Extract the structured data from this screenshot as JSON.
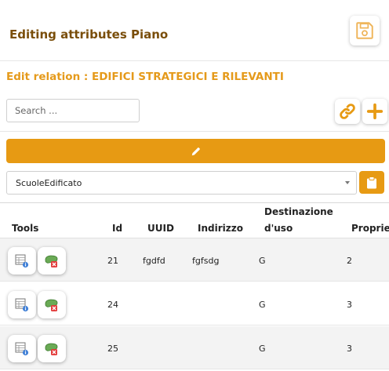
{
  "header": {
    "title": "Editing attributes Piano",
    "save_icon": "floppy-disk-icon"
  },
  "relation": {
    "title": "Edit relation : EDIFICI STRATEGICI E RILEVANTI"
  },
  "search": {
    "placeholder": "Search ...",
    "value": ""
  },
  "toolbar": {
    "link_icon": "link-icon",
    "add_icon": "plus-icon",
    "edit_icon": "pencil-icon",
    "clipboard_icon": "clipboard-icon"
  },
  "select": {
    "value": "ScuoleEdificato"
  },
  "colors": {
    "accent": "#e79a13",
    "title": "#7a4e0a",
    "relation_title": "#e59a1b"
  },
  "table": {
    "columns": [
      "Tools",
      "Id",
      "UUID",
      "Indirizzo",
      "Destinazione",
      "d'uso",
      "Propriet"
    ],
    "rows": [
      {
        "id": "21",
        "uuid": "fgdfd",
        "indirizzo": "fgfsdg",
        "destinazione": "G",
        "proprieta": "2"
      },
      {
        "id": "24",
        "uuid": "",
        "indirizzo": "",
        "destinazione": "G",
        "proprieta": "3"
      },
      {
        "id": "25",
        "uuid": "",
        "indirizzo": "",
        "destinazione": "G",
        "proprieta": "3"
      }
    ]
  }
}
